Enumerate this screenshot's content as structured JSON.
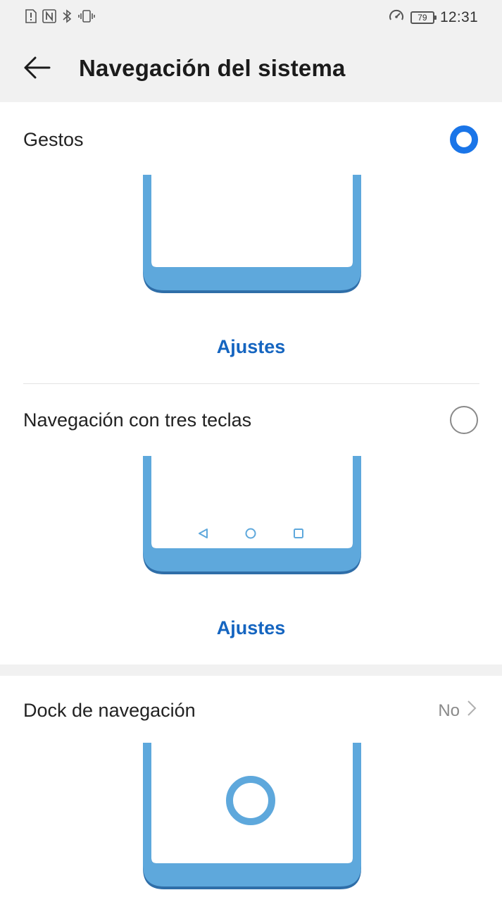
{
  "status_bar": {
    "left_icons": [
      "alert-icon",
      "nfc-icon",
      "bluetooth-icon",
      "vibrate-icon"
    ],
    "right_icons": [
      "data-saver-icon",
      "battery-icon"
    ],
    "battery_level": "79",
    "time": "12:31"
  },
  "header": {
    "title": "Navegación del sistema",
    "back_icon": "arrow-left-icon"
  },
  "options": [
    {
      "label": "Gestos",
      "selected": true,
      "settings_label": "Ajustes"
    },
    {
      "label": "Navegación con tres teclas",
      "selected": false,
      "settings_label": "Ajustes"
    }
  ],
  "dock": {
    "label": "Dock de navegación",
    "value": "No",
    "chevron_icon": "chevron-right-icon"
  },
  "colors": {
    "accent": "#1a75e8",
    "link": "#1565c0",
    "illustration": "#5ea8dc",
    "illustration_shadow": "#2f6ea8",
    "band": "#f1f1f1"
  }
}
